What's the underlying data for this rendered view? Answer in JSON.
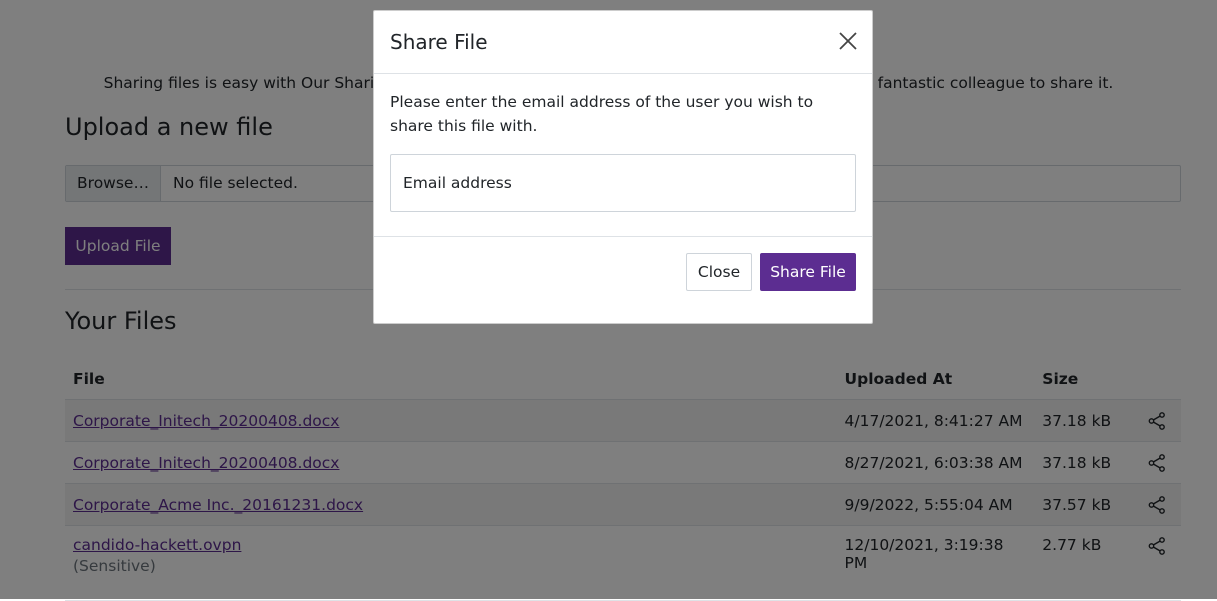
{
  "page": {
    "intro_text": "Sharing files is easy with Our Sharing! Keep your files safe and just choose the email of your fellow fantastic colleague to share it.",
    "upload_heading": "Upload a new file",
    "browse_label": "Browse…",
    "file_status": "No file selected.",
    "upload_button": "Upload File",
    "files_heading": "Your Files",
    "columns": {
      "file": "File",
      "uploaded_at": "Uploaded At",
      "size": "Size"
    },
    "files": [
      {
        "name": "Corporate_Initech_20200408.docx",
        "uploaded_at": "4/17/2021, 8:41:27 AM",
        "size": "37.18 kB",
        "note": ""
      },
      {
        "name": "Corporate_Initech_20200408.docx",
        "uploaded_at": "8/27/2021, 6:03:38 AM",
        "size": "37.18 kB",
        "note": ""
      },
      {
        "name": "Corporate_Acme Inc._20161231.docx",
        "uploaded_at": "9/9/2022, 5:55:04 AM",
        "size": "37.57 kB",
        "note": ""
      },
      {
        "name": "candido-hackett.ovpn",
        "uploaded_at": "12/10/2021, 3:19:38 PM",
        "size": "2.77 kB",
        "note": "(Sensitive)"
      }
    ],
    "share_icon": "share-icon"
  },
  "modal": {
    "title": "Share File",
    "close_icon": "close-icon",
    "body_text": "Please enter the email address of the user you wish to share this file with.",
    "email_placeholder": "Email address",
    "email_value": "",
    "close_button": "Close",
    "share_button": "Share File"
  },
  "colors": {
    "brand": "#5c2d91",
    "overlay": "rgba(0,0,0,0.5)",
    "row_stripe": "#f2f2f2"
  }
}
